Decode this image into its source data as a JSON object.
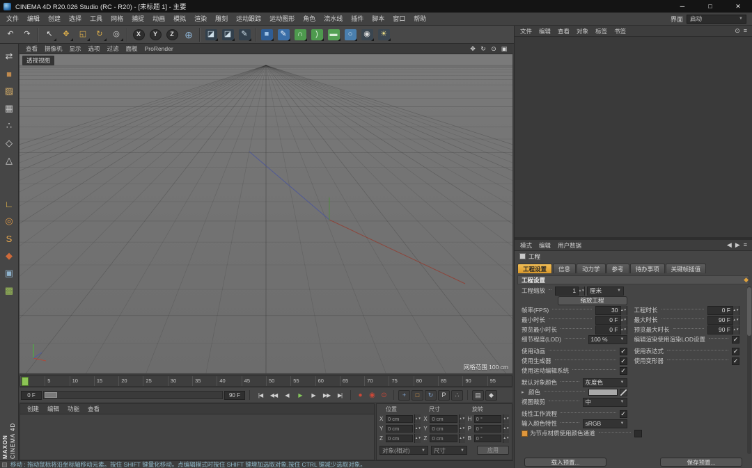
{
  "titlebar": {
    "title": "CINEMA 4D R20.026 Studio (RC - R20) - [未标题 1] - 主要",
    "minimize": "─",
    "maximize": "□",
    "close": "✕"
  },
  "menubar": {
    "items": [
      "文件",
      "编辑",
      "创建",
      "选择",
      "工具",
      "网格",
      "捕捉",
      "动画",
      "模拟",
      "渲染",
      "雕刻",
      "运动跟踪",
      "运动图形",
      "角色",
      "流水线",
      "插件",
      "脚本",
      "窗口",
      "帮助"
    ],
    "right_label": "界面",
    "layout_value": "启动"
  },
  "toolbar": {
    "history": [
      {
        "name": "undo-button",
        "glyph": "↶",
        "color": "#dcdcdc"
      },
      {
        "name": "redo-button",
        "glyph": "↷",
        "color": "#dcdcdc"
      }
    ],
    "tools": [
      {
        "name": "live-selection-tool",
        "glyph": "↖",
        "color": "#e8e8e8"
      },
      {
        "name": "move-tool",
        "glyph": "✥",
        "color": "#e2b24b"
      },
      {
        "name": "scale-tool",
        "glyph": "◱",
        "color": "#e2b24b"
      },
      {
        "name": "rotate-tool",
        "glyph": "↻",
        "color": "#e2b24b"
      },
      {
        "name": "last-used-tool",
        "glyph": "◎",
        "color": "#cfcfcf"
      }
    ],
    "axis": [
      {
        "name": "lock-x-axis-button",
        "label": "X"
      },
      {
        "name": "lock-y-axis-button",
        "label": "Y"
      },
      {
        "name": "lock-z-axis-button",
        "label": "Z"
      }
    ],
    "coord": [
      {
        "name": "coordinate-system-button",
        "glyph": "⊕",
        "color": "#8fb7d9"
      }
    ],
    "render": [
      {
        "name": "render-view-button",
        "glyph": "◪",
        "color": "#cfe0ea",
        "bg": "#32404c"
      },
      {
        "name": "render-picture-viewer-button",
        "glyph": "◪",
        "color": "#cfe0ea",
        "bg": "#32404c"
      },
      {
        "name": "edit-render-settings-button",
        "glyph": "✎",
        "color": "#cfe0ea",
        "bg": "#32404c"
      }
    ],
    "objects": [
      {
        "name": "add-cube-button",
        "glyph": "■",
        "color": "#9fc3e8",
        "bg": "#2f5d94"
      },
      {
        "name": "draw-spline-pen-button",
        "glyph": "✎",
        "color": "#eaf2fa",
        "bg": "#3a6ea8"
      },
      {
        "name": "subdivision-surface-button",
        "glyph": "∩",
        "color": "#eaf6ea",
        "bg": "#4e9a4e"
      },
      {
        "name": "bend-deformer-button",
        "glyph": ")",
        "color": "#eaf6ea",
        "bg": "#4e9a4e"
      },
      {
        "name": "floor-object-button",
        "glyph": "▬",
        "color": "#d8ecd8",
        "bg": "#54a054"
      },
      {
        "name": "sky-object-button",
        "glyph": "○",
        "color": "#d8e8f4",
        "bg": "#4a7fae"
      },
      {
        "name": "camera-object-button",
        "glyph": "◉",
        "color": "#dcdcdc",
        "bg": "#3a4650"
      },
      {
        "name": "light-object-button",
        "glyph": "☀",
        "color": "#f2e48a",
        "bg": "#3a4650"
      }
    ]
  },
  "left_toolbar": {
    "modes": [
      {
        "name": "make-editable-button",
        "glyph": "⇄",
        "color": "#d2d2d2"
      },
      {
        "name": "model-mode-button",
        "glyph": "■",
        "color": "#c08a4e"
      },
      {
        "name": "texture-mode-button",
        "glyph": "▨",
        "color": "#d8b06a"
      },
      {
        "name": "workplane-mode-button",
        "glyph": "▦",
        "color": "#c4c4c4"
      },
      {
        "name": "points-mode-button",
        "glyph": "∴",
        "color": "#d2d2d2"
      },
      {
        "name": "edges-mode-button",
        "glyph": "◇",
        "color": "#d2d2d2"
      },
      {
        "name": "polygons-mode-button",
        "glyph": "△",
        "color": "#d2d2d2"
      }
    ],
    "states": [
      {
        "name": "enable-axis-button",
        "glyph": "∟",
        "color": "#e5b84a"
      },
      {
        "name": "viewport-solo-button",
        "glyph": "◎",
        "color": "#e09a46"
      },
      {
        "name": "snap-settings-button",
        "glyph": "S",
        "color": "#e8a84e"
      },
      {
        "name": "quantize-button",
        "glyph": "◆",
        "color": "#cf6a3a"
      },
      {
        "name": "lock-workplane-button",
        "glyph": "▣",
        "color": "#8fb2cc"
      },
      {
        "name": "layer-palette-button",
        "glyph": "▩",
        "color": "#9fc35a"
      }
    ]
  },
  "viewport": {
    "menu": [
      "查看",
      "摄像机",
      "显示",
      "选项",
      "过滤",
      "面板",
      "ProRender"
    ],
    "nav_icons": [
      {
        "name": "pan-view-icon",
        "glyph": "✥"
      },
      {
        "name": "orbit-view-icon",
        "glyph": "↻"
      },
      {
        "name": "zoom-view-icon",
        "glyph": "⊙"
      },
      {
        "name": "toggle-layout-icon",
        "glyph": "▣"
      }
    ],
    "view_label": "透视视图",
    "grid_range": "网格范围 100 cm"
  },
  "timeline": {
    "ticks": [
      "0",
      "5",
      "10",
      "15",
      "20",
      "25",
      "30",
      "35",
      "40",
      "45",
      "50",
      "55",
      "60",
      "65",
      "70",
      "75",
      "80",
      "85",
      "90",
      "95"
    ],
    "current_frame": "0"
  },
  "transport": {
    "start_value": "0 F",
    "end_value": "90 F",
    "play_buttons": [
      {
        "name": "goto-start-button",
        "glyph": "|◀",
        "color": "#d0d0d0"
      },
      {
        "name": "prev-key-button",
        "glyph": "◀◀",
        "color": "#d0d0d0"
      },
      {
        "name": "prev-frame-button",
        "glyph": "◀",
        "color": "#d0d0d0"
      },
      {
        "name": "play-button",
        "glyph": "▶",
        "color": "#86c95c"
      },
      {
        "name": "next-frame-button",
        "glyph": "▶",
        "color": "#d0d0d0"
      },
      {
        "name": "next-key-button",
        "glyph": "▶▶",
        "color": "#d0d0d0"
      },
      {
        "name": "goto-end-button",
        "glyph": "▶|",
        "color": "#d0d0d0"
      }
    ],
    "record_buttons": [
      {
        "name": "record-keyframe-button",
        "glyph": "●",
        "color": "#cc4838"
      },
      {
        "name": "autokeying-button",
        "glyph": "◉",
        "color": "#cc4838"
      },
      {
        "name": "record-options-button",
        "glyph": "⊙",
        "color": "#cc4838"
      }
    ],
    "track_toggles": [
      {
        "name": "record-position-toggle",
        "glyph": "+",
        "color": "#7fa3cf"
      },
      {
        "name": "record-scale-toggle",
        "glyph": "□",
        "color": "#dc9a4a"
      },
      {
        "name": "record-rotation-toggle",
        "glyph": "↻",
        "color": "#7fa3cf"
      },
      {
        "name": "record-parameter-toggle",
        "glyph": "P",
        "color": "#cfcfcf"
      },
      {
        "name": "record-pla-toggle",
        "glyph": "∴",
        "color": "#cfcfcf"
      }
    ],
    "extra_buttons": [
      {
        "name": "keyframe-selection-button",
        "glyph": "▤",
        "color": "#cfcfcf"
      },
      {
        "name": "timeline-options-button",
        "glyph": "◆",
        "color": "#cfcfcf"
      }
    ]
  },
  "materials": {
    "menu": [
      "创建",
      "编辑",
      "功能",
      "查看"
    ]
  },
  "coordinates": {
    "headers": [
      "位置",
      "尺寸",
      "旋转"
    ],
    "position": [
      {
        "axis": "X",
        "value": "0 cm"
      },
      {
        "axis": "Y",
        "value": "0 cm"
      },
      {
        "axis": "Z",
        "value": "0 cm"
      }
    ],
    "size": [
      {
        "axis": "X",
        "value": "0 cm"
      },
      {
        "axis": "Y",
        "value": "0 cm"
      },
      {
        "axis": "Z",
        "value": "0 cm"
      }
    ],
    "rotation": [
      {
        "axis": "H",
        "value": "0 °"
      },
      {
        "axis": "P",
        "value": "0 °"
      },
      {
        "axis": "B",
        "value": "0 °"
      }
    ],
    "space_dropdown": "对象(相对)",
    "mode_dropdown": "尺寸",
    "apply_button": "应用"
  },
  "object_manager": {
    "menu": [
      "文件",
      "编辑",
      "查看",
      "对象",
      "标签",
      "书签"
    ],
    "icons": [
      {
        "name": "search-icon",
        "glyph": "⊙"
      },
      {
        "name": "panel-menu-icon",
        "glyph": "≡"
      }
    ]
  },
  "attributes": {
    "menu": [
      "模式",
      "编辑",
      "用户数据"
    ],
    "icons": [
      {
        "name": "history-back-icon",
        "glyph": "◀"
      },
      {
        "name": "history-forward-icon",
        "glyph": "▶"
      },
      {
        "name": "panel-menu-icon",
        "glyph": "≡"
      }
    ],
    "object_label": "工程",
    "tabs": [
      {
        "label": "工程设置",
        "active": true
      },
      {
        "label": "信息"
      },
      {
        "label": "动力学"
      },
      {
        "label": "参考"
      },
      {
        "label": "待办事项"
      },
      {
        "label": "关键帧插值"
      }
    ],
    "section": "工程设置",
    "scale": {
      "label": "工程缩放",
      "value": "1",
      "unit": "厘米"
    },
    "scale_button": "缩放工程",
    "fps": {
      "label": "帧率(FPS)",
      "value": "30"
    },
    "duration": {
      "label": "工程时长",
      "value": "0 F"
    },
    "min_time": {
      "label": "最小时长",
      "value": "0 F"
    },
    "max_time": {
      "label": "最大时长",
      "value": "90 F"
    },
    "preview_min": {
      "label": "预览最小时长",
      "value": "0 F"
    },
    "preview_max": {
      "label": "预览最大时长",
      "value": "90 F"
    },
    "lod": {
      "label": "细节程度(LOD)",
      "value": "100 %"
    },
    "render_lod": {
      "label": "编辑渲染使用渲染LOD设置",
      "checked": "✓"
    },
    "use_animation": {
      "label": "使用动画",
      "checked": "✓"
    },
    "use_expressions": {
      "label": "使用表达式",
      "checked": "✓"
    },
    "use_generators": {
      "label": "使用生成器",
      "checked": "✓"
    },
    "use_deformers": {
      "label": "使用变形器",
      "checked": "✓"
    },
    "use_motion_system": {
      "label": "使用运动编辑系统",
      "checked": "✓"
    },
    "default_color": {
      "label": "默认对象颜色",
      "value": "灰度色"
    },
    "color": {
      "label": "颜色"
    },
    "view_clipping": {
      "label": "视图裁剪",
      "value": "中"
    },
    "linear_workflow": {
      "label": "线性工作流程",
      "checked": "✓"
    },
    "input_profile": {
      "label": "输入颜色特性",
      "value": "sRGB"
    },
    "node_colors": {
      "label": "为节点材质使用颜色通道"
    },
    "load_preset": "载入预置...",
    "save_preset": "保存预置..."
  },
  "statusbar": {
    "text": "移动 : 拖动鼠标将沿坐标轴移动元素。按住 SHIFT 键量化移动。点编辑模式时按住 SHIFT 键增加选取对象,按住 CTRL 键减少选取对象。"
  },
  "brand": {
    "maxon": "MAXON",
    "c4d": "CINEMA 4D"
  }
}
